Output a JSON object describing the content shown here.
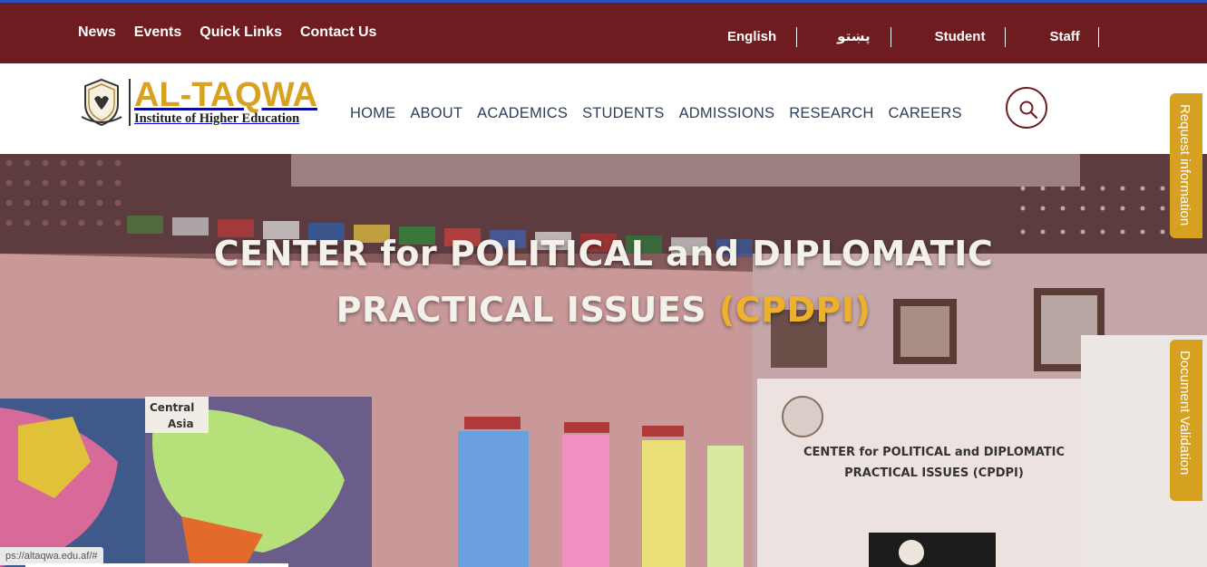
{
  "top_bar": {
    "links": [
      "News",
      "Events",
      "Quick Links",
      "Contact Us"
    ],
    "right_links": [
      "English",
      "پښتو",
      "Student",
      "Staff"
    ]
  },
  "brand": {
    "name": "AL-TAQWA",
    "subtitle": "Institute of Higher Education"
  },
  "nav": {
    "items": [
      "HOME",
      "ABOUT",
      "ACADEMICS",
      "STUDENTS",
      "ADMISSIONS",
      "RESEARCH",
      "CAREERS"
    ]
  },
  "search": {
    "icon": "search-icon"
  },
  "hero": {
    "title_line1": "CENTER for POLITICAL and DIPLOMATIC",
    "title_line2": "PRACTICAL ISSUES",
    "acronym": "(CPDPI)",
    "banner_line1": "CENTER for POLITICAL and DIPLOMATIC",
    "banner_line2": "PRACTICAL ISSUES (CPDPI)"
  },
  "side_tabs": {
    "request": "Request information",
    "validation": "Document Validation"
  },
  "status_bar": {
    "url": "ps://altaqwa.edu.af/#"
  },
  "colors": {
    "brand_maroon": "#6e1c1f",
    "brand_gold": "#d6a020",
    "nav_text": "#2b3f5c"
  }
}
